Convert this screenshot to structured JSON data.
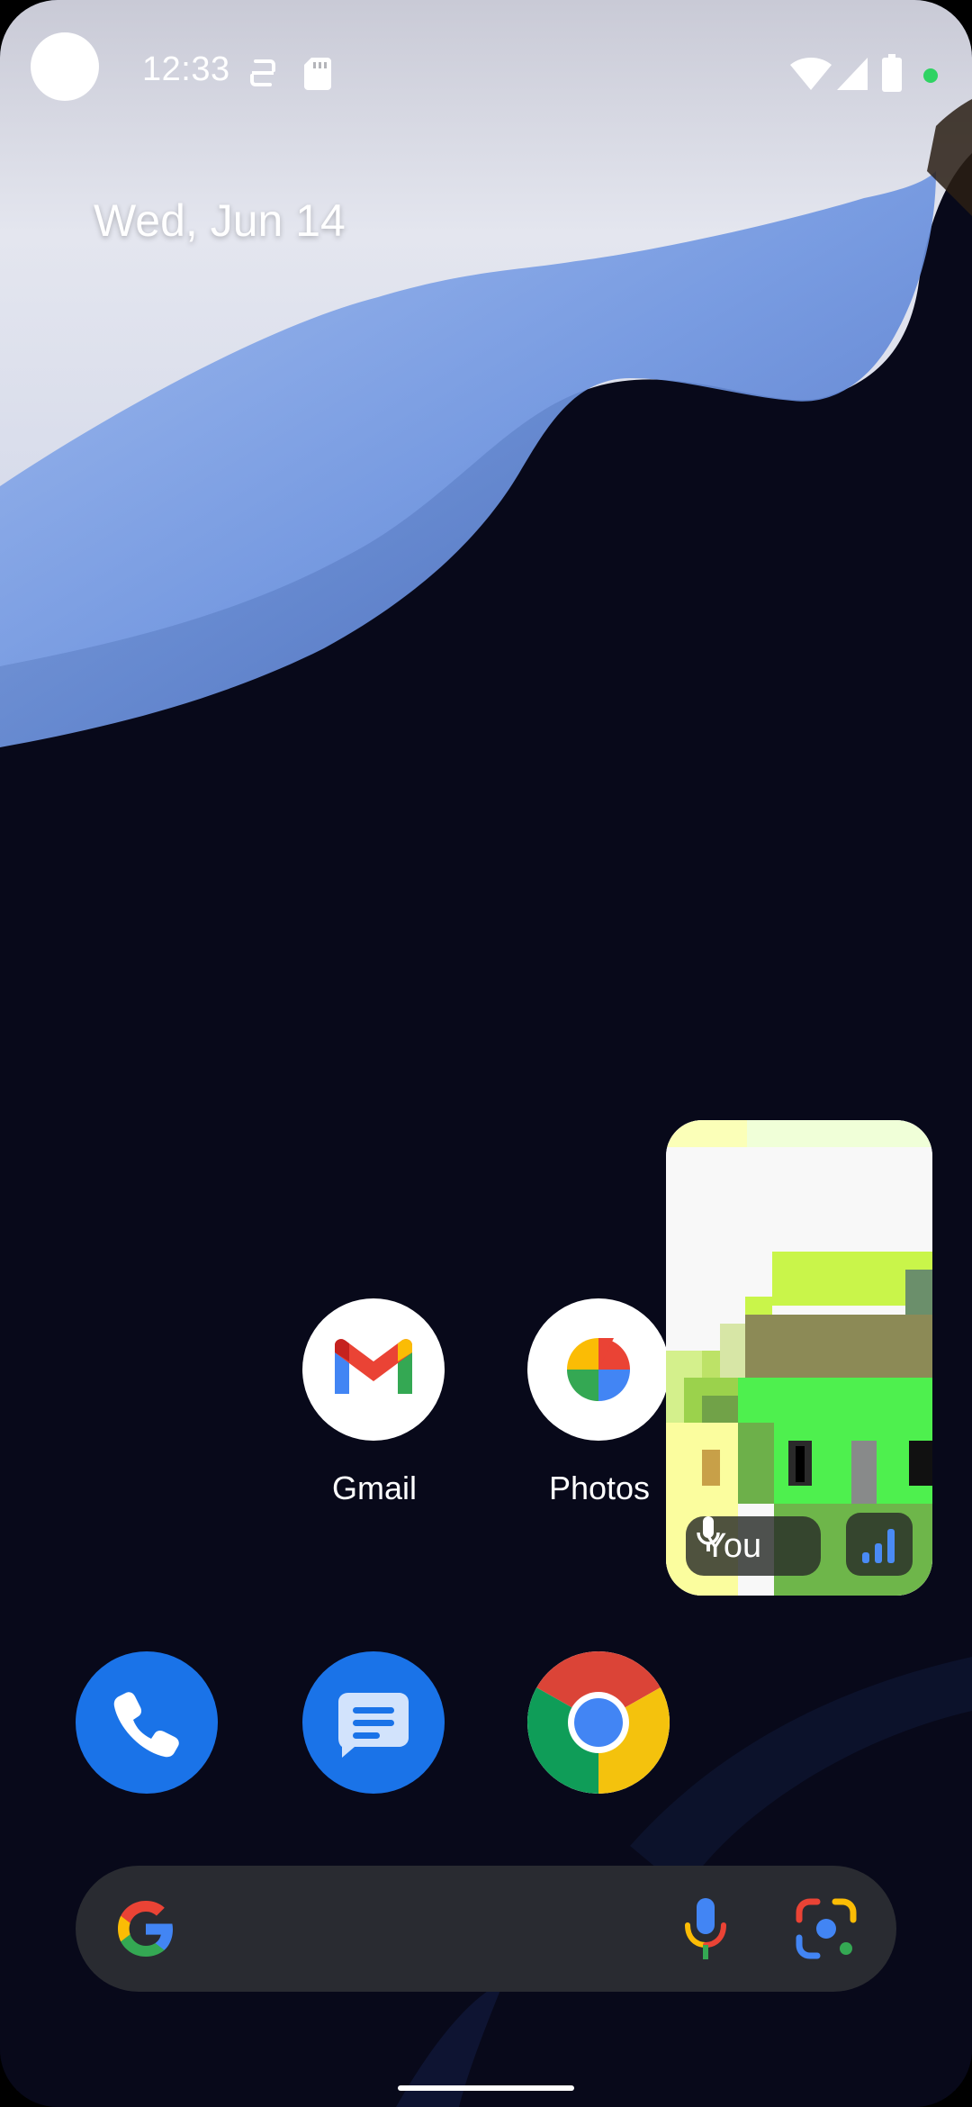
{
  "status_bar": {
    "time": "12:33"
  },
  "home": {
    "date": "Wed, Jun 14",
    "apps": [
      {
        "label": "Gmail",
        "icon": "gmail-icon"
      },
      {
        "label": "Photos",
        "icon": "photos-icon"
      }
    ],
    "dock": [
      {
        "icon": "phone-icon"
      },
      {
        "icon": "messages-icon"
      },
      {
        "icon": "chrome-icon"
      }
    ]
  },
  "pip_call": {
    "participant_label": "You"
  },
  "search_bar": {
    "logo": "google-g-icon",
    "voice": "mic-icon",
    "lens": "lens-icon"
  },
  "colors": {
    "google_blue": "#4285F4",
    "google_red": "#EA4335",
    "google_yellow": "#FBBC05",
    "google_green": "#34A853",
    "dock_blue": "#1a73e8"
  }
}
